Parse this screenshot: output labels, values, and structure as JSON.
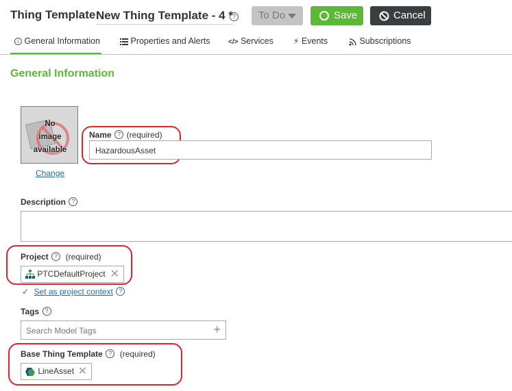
{
  "header": {
    "entity_type": "Thing Template:",
    "entity_name": "New Thing Template - 4 *",
    "status_label": "To Do",
    "save_label": "Save",
    "cancel_label": "Cancel"
  },
  "tabs": [
    {
      "label": "General Information",
      "icon": "info-icon",
      "active": true
    },
    {
      "label": "Properties and Alerts",
      "icon": "list-icon",
      "active": false
    },
    {
      "label": "Services",
      "icon": "code-icon",
      "active": false
    },
    {
      "label": "Events",
      "icon": "lightning-icon",
      "active": false
    },
    {
      "label": "Subscriptions",
      "icon": "rss-icon",
      "active": false
    }
  ],
  "section_title": "General Information",
  "image": {
    "placeholder_lines": [
      "No",
      "image",
      "available"
    ],
    "change_label": "Change"
  },
  "name_field": {
    "label": "Name",
    "required": "(required)",
    "value": "HazardousAsset"
  },
  "description_field": {
    "label": "Description",
    "value": ""
  },
  "project_field": {
    "label": "Project",
    "required": "(required)",
    "value": "PTCDefaultProject",
    "context_link": "Set as project context"
  },
  "tags_field": {
    "label": "Tags",
    "placeholder": "Search Model Tags"
  },
  "base_template_field": {
    "label": "Base Thing Template",
    "required": "(required)",
    "value": "LineAsset"
  },
  "colors": {
    "accent": "#5cb936",
    "dark": "#3a3e40",
    "highlight": "#d9252f",
    "link": "#1f6fb5"
  }
}
